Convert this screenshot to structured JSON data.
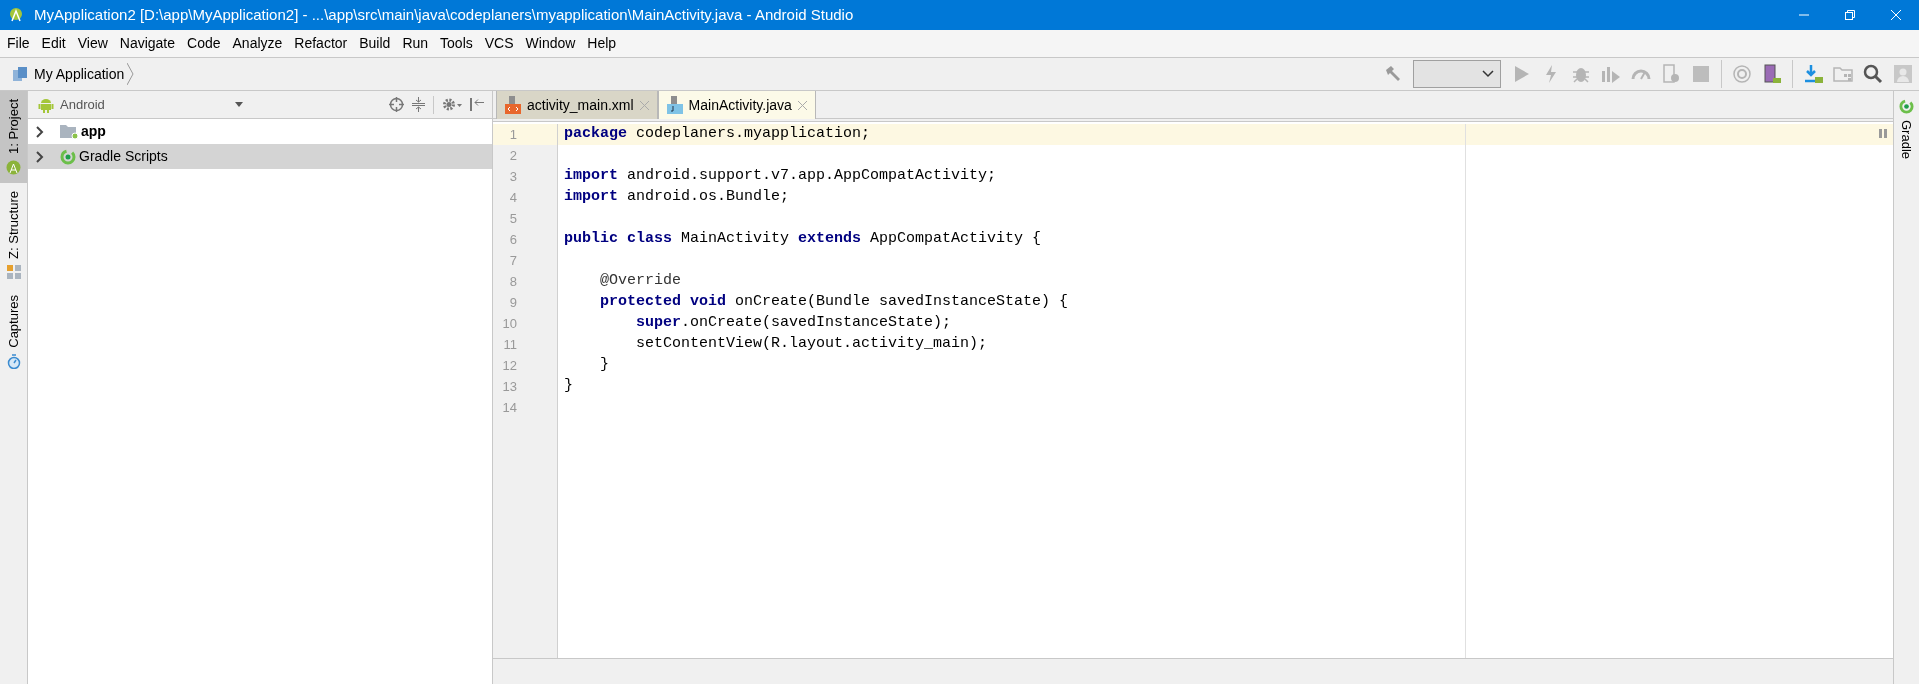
{
  "window": {
    "title": "MyApplication2 [D:\\app\\MyApplication2] - ...\\app\\src\\main\\java\\codeplaners\\myapplication\\MainActivity.java - Android Studio"
  },
  "menu": [
    "File",
    "Edit",
    "View",
    "Navigate",
    "Code",
    "Analyze",
    "Refactor",
    "Build",
    "Run",
    "Tools",
    "VCS",
    "Window",
    "Help"
  ],
  "breadcrumb": {
    "label": "My Application"
  },
  "left_tool_tabs": [
    {
      "label": "1: Project",
      "selected": true,
      "kind": "android"
    },
    {
      "label": "Z: Structure",
      "selected": false,
      "kind": "structure"
    },
    {
      "label": "Captures",
      "selected": false,
      "kind": "captures"
    }
  ],
  "project_panel": {
    "view": "Android",
    "items": [
      {
        "label": "app",
        "kind": "module",
        "selected": false,
        "expanded": false
      },
      {
        "label": "Gradle Scripts",
        "kind": "gradle",
        "selected": true,
        "expanded": false
      }
    ]
  },
  "editor_tabs": [
    {
      "label": "activity_main.xml",
      "kind": "xml",
      "selected": false
    },
    {
      "label": "MainActivity.java",
      "kind": "java",
      "selected": true
    }
  ],
  "code_lines": [
    {
      "number": "1",
      "highlighted": true,
      "tokens": [
        {
          "text": "package",
          "kind": "keyword"
        },
        {
          "text": " codeplaners.myapplication;",
          "kind": "plain"
        }
      ]
    },
    {
      "number": "2",
      "highlighted": false
    },
    {
      "number": "3",
      "highlighted": false,
      "tokens": [
        {
          "text": "import",
          "kind": "keyword"
        },
        {
          "text": " android.support.v7.app.AppCompatActivity;",
          "kind": "plain"
        }
      ]
    },
    {
      "number": "4",
      "highlighted": false,
      "tokens": [
        {
          "text": "import",
          "kind": "keyword"
        },
        {
          "text": " android.os.Bundle;",
          "kind": "plain"
        }
      ]
    },
    {
      "number": "5",
      "highlighted": false
    },
    {
      "number": "6",
      "highlighted": false,
      "tokens": [
        {
          "text": "public class",
          "kind": "keyword"
        },
        {
          "text": " MainActivity ",
          "kind": "plain"
        },
        {
          "text": "extends",
          "kind": "keyword"
        },
        {
          "text": " AppCompatActivity {",
          "kind": "plain"
        }
      ]
    },
    {
      "number": "7",
      "highlighted": false
    },
    {
      "number": "8",
      "highlighted": false,
      "tokens": [
        {
          "text": "    @Override",
          "kind": "annotation"
        }
      ]
    },
    {
      "number": "9",
      "highlighted": false,
      "tokens": [
        {
          "text": "    protected void",
          "kind": "keyword"
        },
        {
          "text": " onCreate(Bundle savedInstanceState) {",
          "kind": "plain"
        }
      ]
    },
    {
      "number": "10",
      "highlighted": false,
      "tokens": [
        {
          "text": "        super",
          "kind": "keyword"
        },
        {
          "text": ".onCreate(savedInstanceState);",
          "kind": "plain"
        }
      ]
    },
    {
      "number": "11",
      "highlighted": false,
      "tokens": [
        {
          "text": "        setContentView(R.layout.activity_main);",
          "kind": "plain"
        }
      ]
    },
    {
      "number": "12",
      "highlighted": false,
      "tokens": [
        {
          "text": "    }",
          "kind": "plain"
        }
      ]
    },
    {
      "number": "13",
      "highlighted": false,
      "tokens": [
        {
          "text": "}",
          "kind": "plain"
        }
      ]
    },
    {
      "number": "14",
      "highlighted": false
    }
  ],
  "right_tool_tabs": [
    {
      "label": "Gradle",
      "selected": false
    }
  ]
}
